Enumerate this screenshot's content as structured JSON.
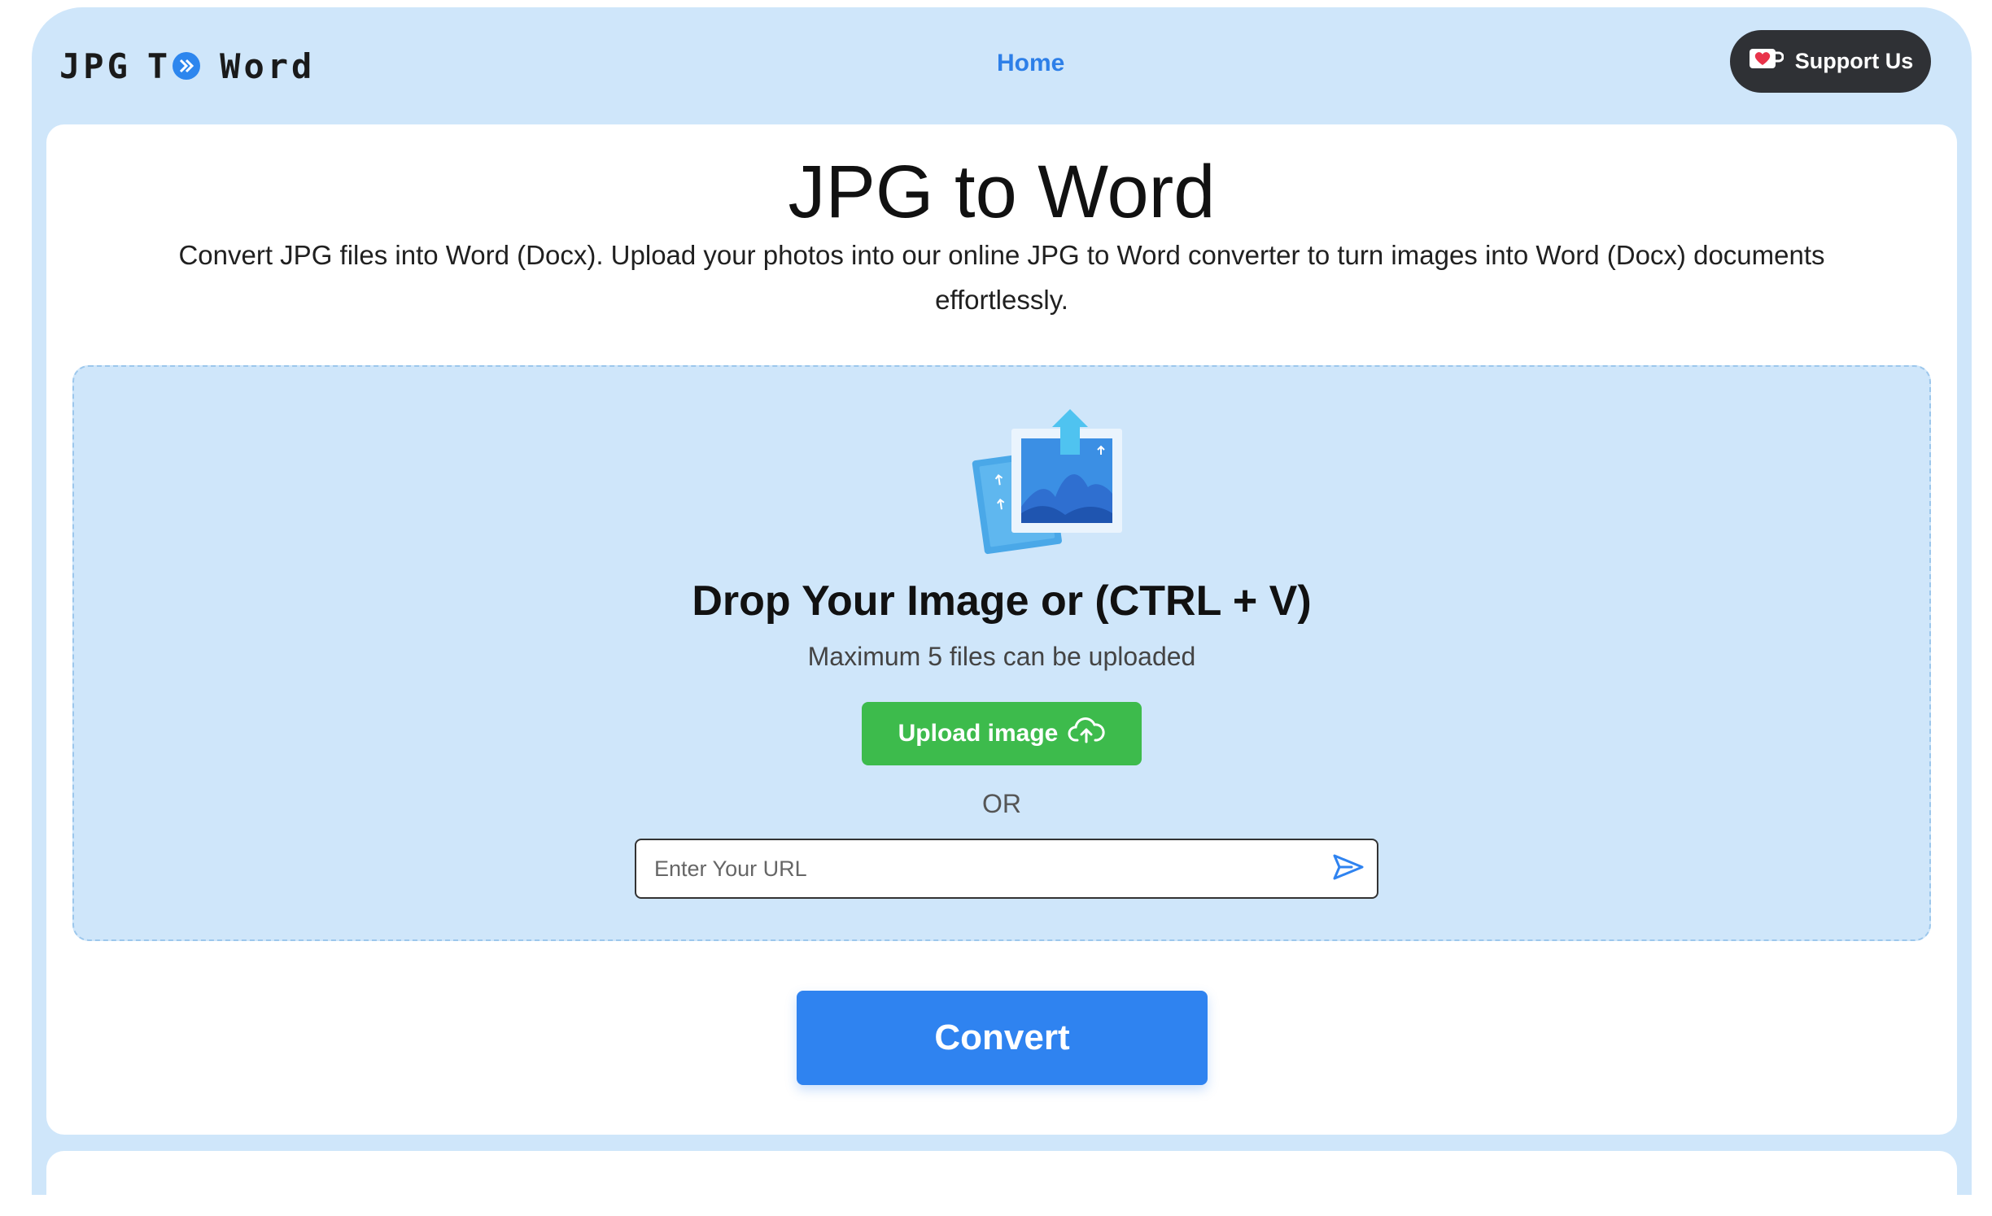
{
  "header": {
    "logo_parts": [
      "JPG",
      "T",
      "Word"
    ],
    "nav_home": "Home",
    "support_label": "Support Us"
  },
  "main": {
    "title": "JPG to Word",
    "description": "Convert JPG files into Word (Docx). Upload your photos into our online JPG to Word converter to turn images into Word (Docx) documents effortlessly."
  },
  "dropzone": {
    "title": "Drop Your Image or (CTRL + V)",
    "subtitle": "Maximum 5 files can be uploaded",
    "upload_label": "Upload image",
    "or_label": "OR",
    "url_placeholder": "Enter Your URL",
    "url_value": ""
  },
  "actions": {
    "convert_label": "Convert"
  },
  "icons": {
    "logo_badge": "double-chevron-right-icon",
    "support": "heart-icon",
    "upload": "cloud-upload-icon",
    "send": "send-icon",
    "dropzone": "image-upload-illustration"
  },
  "colors": {
    "page_bg": "#cfe6fa",
    "accent_blue": "#2f83f0",
    "upload_green": "#3dbb4c",
    "support_dark": "#2f3135",
    "heart_red": "#e8334a"
  }
}
